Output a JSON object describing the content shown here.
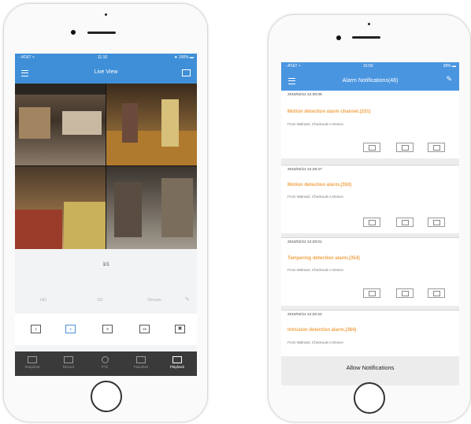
{
  "left_phone": {
    "status": {
      "carrier": "∙∙∙AT&T ◓",
      "time": "11:10",
      "battery": "★ 100% ▬"
    },
    "nav": {
      "title": "Live View"
    },
    "page_indicator": "1/1",
    "quality_tabs": [
      "HD",
      "SD",
      "Stream"
    ],
    "grid_buttons": [
      "1",
      "4",
      "9",
      "16"
    ],
    "tabs": [
      "Snapshot",
      "Record",
      "PTZ",
      "Favorites",
      "Playback"
    ],
    "colors": {
      "nav": "#3f8fd8",
      "tabbar": "#3a3a3a",
      "selected": "#4a90d9"
    }
  },
  "right_phone": {
    "status": {
      "carrier": "∙∙∙AT&T ◓",
      "time": "15:50",
      "battery": "39% ▬"
    },
    "nav": {
      "title": "Alarm Notifications(48)"
    },
    "notifications": [
      {
        "time": "2018/02/11 12:30:06",
        "title": "Motion detection alarm channel.(331)",
        "source": "From Walmart, Checkouts A Device"
      },
      {
        "time": "2018/02/11 12:29:47",
        "title": "Motion detection alarm.(350)",
        "source": "From Walmart, Checkouts A Device"
      },
      {
        "time": "2018/02/11 12:28:01",
        "title": "Tampering detection alarm.(354)",
        "source": "From Walmart, Checkouts A Device"
      },
      {
        "time": "2018/02/11 12:20:22",
        "title": "Intrusion detection alarm.(384)",
        "source": "From Walmart, Checkouts A Device"
      }
    ],
    "allow_button": "Allow Notifications",
    "colors": {
      "nav": "#4a95e0",
      "alarm_title": "#f0a44a"
    }
  }
}
